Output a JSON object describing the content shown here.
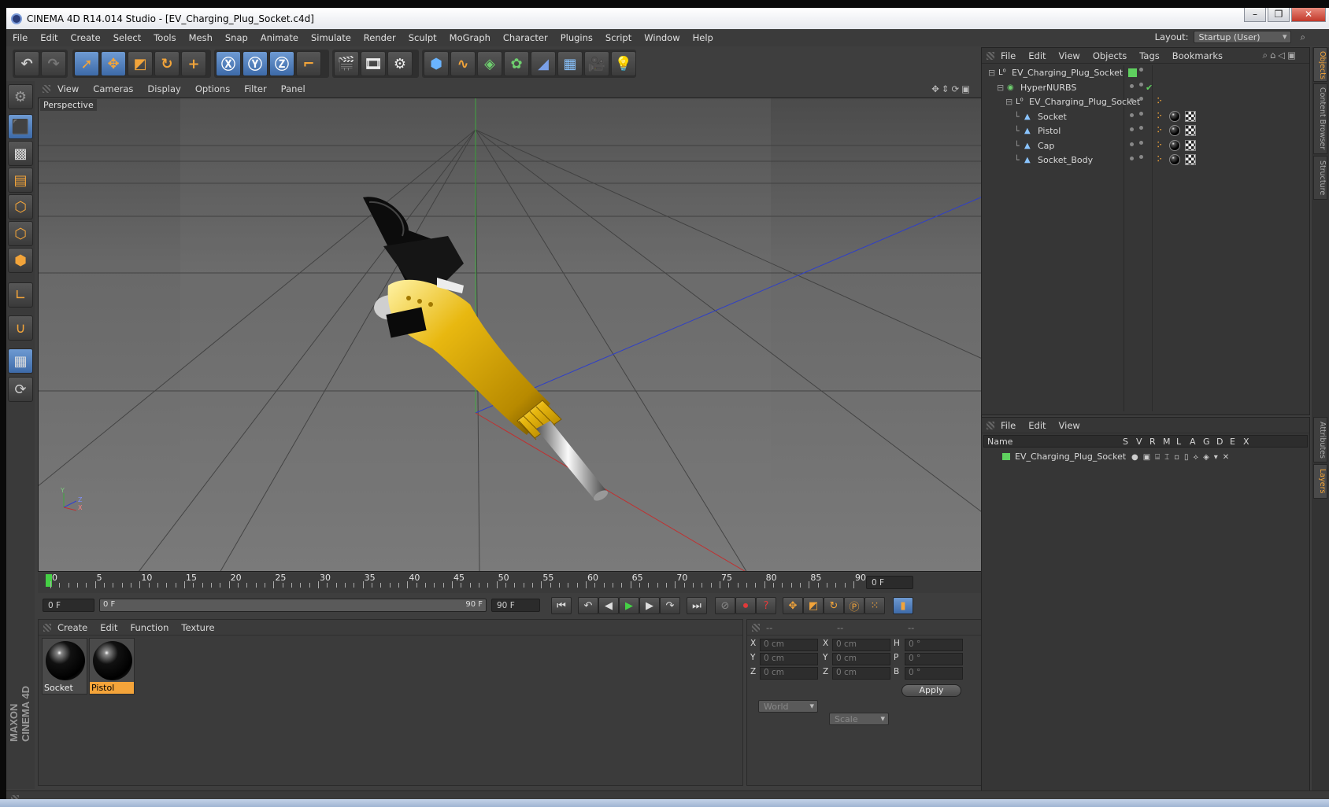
{
  "window": {
    "title": "CINEMA 4D R14.014 Studio - [EV_Charging_Plug_Socket.c4d]",
    "controls": [
      "–",
      "❐",
      "✕"
    ]
  },
  "menu": {
    "items": [
      "File",
      "Edit",
      "Create",
      "Select",
      "Tools",
      "Mesh",
      "Snap",
      "Animate",
      "Simulate",
      "Render",
      "Sculpt",
      "MoGraph",
      "Character",
      "Plugins",
      "Script",
      "Window",
      "Help"
    ],
    "layout_label": "Layout:",
    "layout_value": "Startup (User)"
  },
  "viewport": {
    "menu": [
      "View",
      "Cameras",
      "Display",
      "Options",
      "Filter",
      "Panel"
    ],
    "camera_label": "Perspective",
    "axis": {
      "y": "Y",
      "z": "Z",
      "x": "X"
    }
  },
  "timeline": {
    "ticks": [
      "0",
      "5",
      "10",
      "15",
      "20",
      "25",
      "30",
      "35",
      "40",
      "45",
      "50",
      "55",
      "60",
      "65",
      "70",
      "75",
      "80",
      "85",
      "90"
    ],
    "current_frame": "0 F",
    "start_field": "0 F",
    "range_start": "0 F",
    "range_end": "90 F",
    "end_field": "90 F"
  },
  "materials": {
    "menu": [
      "Create",
      "Edit",
      "Function",
      "Texture"
    ],
    "items": [
      {
        "name": "Socket",
        "selected": false
      },
      {
        "name": "Pistol",
        "selected": true
      }
    ]
  },
  "coordinates": {
    "headers": [
      "--",
      "--",
      "--"
    ],
    "rows": [
      {
        "a_label": "X",
        "a_val": "0 cm",
        "b_label": "X",
        "b_val": "0 cm",
        "c_label": "H",
        "c_val": "0 °"
      },
      {
        "a_label": "Y",
        "a_val": "0 cm",
        "b_label": "Y",
        "b_val": "0 cm",
        "c_label": "P",
        "c_val": "0 °"
      },
      {
        "a_label": "Z",
        "a_val": "0 cm",
        "b_label": "Z",
        "b_val": "0 cm",
        "c_label": "B",
        "c_val": "0 °"
      }
    ],
    "space": "World",
    "mode": "Scale",
    "apply_label": "Apply"
  },
  "objects": {
    "menu": [
      "File",
      "Edit",
      "View",
      "Objects",
      "Tags",
      "Bookmarks"
    ],
    "tree": [
      {
        "name": "EV_Charging_Plug_Socket",
        "indent": 0,
        "icon": "null"
      },
      {
        "name": "HyperNURBS",
        "indent": 1,
        "icon": "hypernurbs"
      },
      {
        "name": "EV_Charging_Plug_Socket",
        "indent": 2,
        "icon": "null"
      },
      {
        "name": "Socket",
        "indent": 3,
        "icon": "polygon"
      },
      {
        "name": "Pistol",
        "indent": 3,
        "icon": "polygon"
      },
      {
        "name": "Cap",
        "indent": 3,
        "icon": "polygon"
      },
      {
        "name": "Socket_Body",
        "indent": 3,
        "icon": "polygon"
      }
    ]
  },
  "layers": {
    "menu": [
      "File",
      "Edit",
      "View"
    ],
    "columns": [
      "Name",
      "S",
      "V",
      "R",
      "M",
      "L",
      "A",
      "G",
      "D",
      "E",
      "X"
    ],
    "rows": [
      {
        "name": "EV_Charging_Plug_Socket",
        "color": "#5fd05f"
      }
    ]
  },
  "side_tabs": [
    "Objects",
    "Content Browser",
    "Structure",
    "Attributes",
    "Layers"
  ],
  "brand": "MAXON CINEMA 4D",
  "colors": {
    "accent": "#f2a43a",
    "selection": "#5a8fd6",
    "object_green": "#5fd05f"
  }
}
